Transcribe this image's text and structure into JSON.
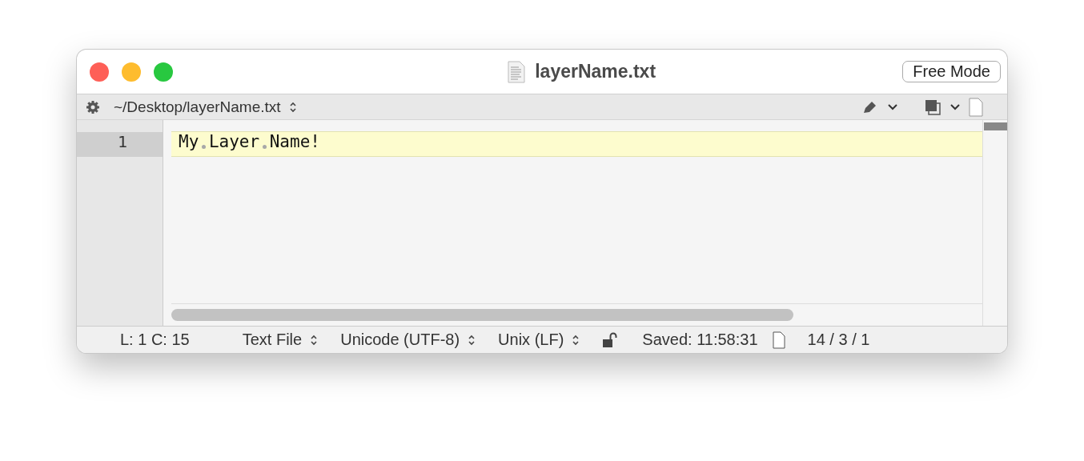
{
  "window": {
    "title": "layerName.txt",
    "mode_button": "Free Mode"
  },
  "toolbar": {
    "path": "~/Desktop/layerName.txt"
  },
  "editor": {
    "lines": [
      {
        "number": "1",
        "text": "My Layer Name!",
        "selected": true
      }
    ],
    "show_invisibles": true
  },
  "status_bar": {
    "position": "L: 1 C: 15",
    "syntax": "Text File",
    "encoding": "Unicode (UTF-8)",
    "line_endings": "Unix (LF)",
    "locked": false,
    "saved": "Saved: 11:58:31",
    "counts": "14 / 3 / 1"
  }
}
